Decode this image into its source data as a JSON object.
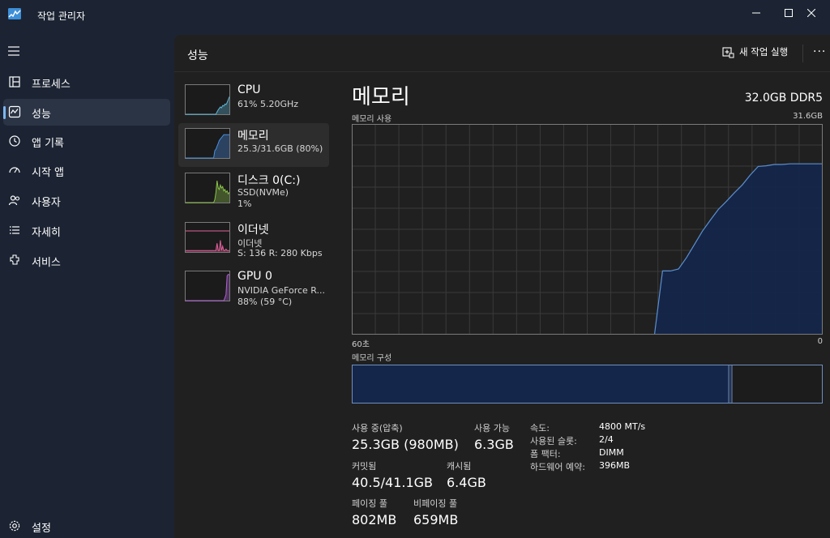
{
  "window": {
    "title": "작업 관리자"
  },
  "sidebar": {
    "items": [
      {
        "label": "프로세스",
        "icon": "processes-icon"
      },
      {
        "label": "성능",
        "icon": "performance-icon"
      },
      {
        "label": "앱 기록",
        "icon": "app-history-icon"
      },
      {
        "label": "시작 앱",
        "icon": "startup-apps-icon"
      },
      {
        "label": "사용자",
        "icon": "users-icon"
      },
      {
        "label": "자세히",
        "icon": "details-icon"
      },
      {
        "label": "서비스",
        "icon": "services-icon"
      }
    ],
    "active_index": 1,
    "settings_label": "설정"
  },
  "header": {
    "title": "성능",
    "new_task_label": "새 작업 실행",
    "more_label": "···"
  },
  "devices": [
    {
      "name": "CPU",
      "line1": "61% 5.20GHz",
      "line2": "",
      "color": "#5fb8d6"
    },
    {
      "name": "메모리",
      "line1": "25.3/31.6GB (80%)",
      "line2": "",
      "color": "#4a90e2"
    },
    {
      "name": "디스크 0(C:)",
      "line1": "SSD(NVMe)",
      "line2": "1%",
      "color": "#8bc34a"
    },
    {
      "name": "이더넷",
      "line1": "이더넷",
      "line2": "S: 136 R: 280 Kbps",
      "color": "#e0609a"
    },
    {
      "name": "GPU 0",
      "line1": "NVIDIA GeForce R...",
      "line2": "88% (59 °C)",
      "color": "#b060d6"
    }
  ],
  "memory": {
    "title": "메모리",
    "total": "32.0GB DDR5",
    "usage_label": "메모리 사용",
    "max_label": "31.6GB",
    "axis_left": "60초",
    "axis_right": "0",
    "composition_label": "메모리 구성",
    "composition_used_fraction": 0.805,
    "usage_history_gb": [
      0,
      0,
      0,
      0,
      0,
      0,
      0,
      0,
      0,
      0,
      0,
      0,
      0,
      0,
      0,
      0,
      0,
      0,
      0,
      0,
      0,
      0,
      0,
      0,
      0,
      0,
      0,
      0,
      0,
      0,
      0,
      0,
      0,
      0,
      0,
      0,
      0,
      0,
      0,
      9.5,
      9.5,
      9.8,
      11.5,
      13.5,
      15.5,
      17.2,
      18.8,
      20.0,
      21.3,
      22.5,
      24.0,
      25.3,
      25.4,
      25.6,
      25.6,
      25.7,
      25.7,
      25.7,
      25.7,
      25.7
    ],
    "stats": {
      "in_use_label": "사용 중(압축)",
      "in_use_value": "25.3GB (980MB)",
      "available_label": "사용 가능",
      "available_value": "6.3GB",
      "committed_label": "커밋됨",
      "committed_value": "40.5/41.1GB",
      "cached_label": "캐시됨",
      "cached_value": "6.4GB",
      "paged_label": "페이징 풀",
      "paged_value": "802MB",
      "nonpaged_label": "비페이징 풀",
      "nonpaged_value": "659MB"
    },
    "details": [
      {
        "key": "속도:",
        "value": "4800 MT/s"
      },
      {
        "key": "사용된 슬롯:",
        "value": "2/4"
      },
      {
        "key": "폼 팩터:",
        "value": "DIMM"
      },
      {
        "key": "하드웨어 예약:",
        "value": "396MB"
      }
    ]
  },
  "colors": {
    "accent": "#7eb6f0",
    "graph_line": "#5b8fd0",
    "graph_fill": "#14264a",
    "grid": "#3a3a3a"
  }
}
